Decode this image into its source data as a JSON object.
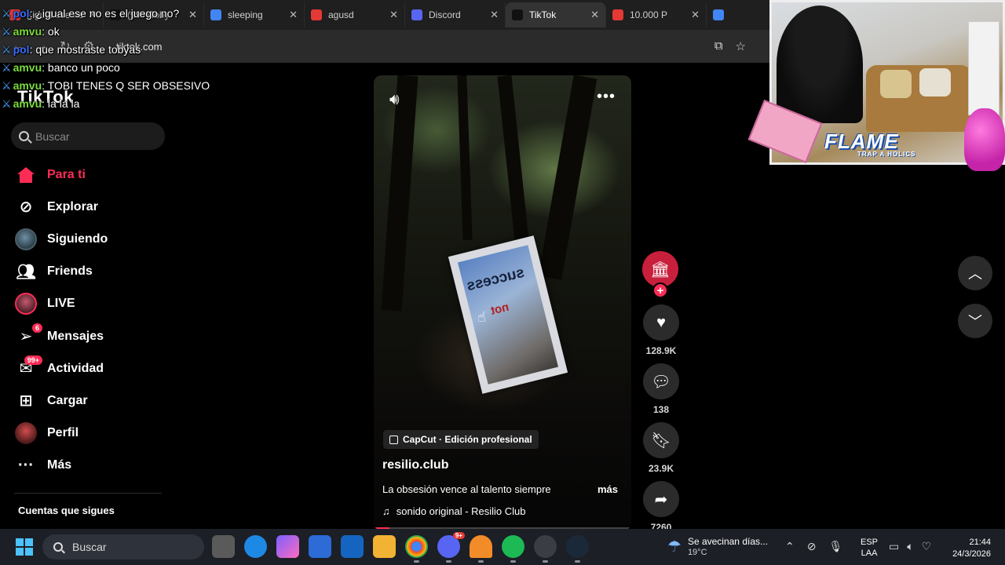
{
  "browser": {
    "tabs": [
      {
        "label": "¿igual ese no es el juego no?",
        "color": "#e53935",
        "active": false
      },
      {
        "label": "(99+)Toby",
        "color": "#111111",
        "active": false
      },
      {
        "label": "sleeping",
        "color": "#4285f4",
        "active": false
      },
      {
        "label": "agusd",
        "color": "#e53935",
        "active": false
      },
      {
        "label": "Discord",
        "color": "#5865f2",
        "active": false
      },
      {
        "label": "TikTok",
        "color": "#111111",
        "active": true
      },
      {
        "label": "10.000 P",
        "color": "#e53935",
        "active": false
      },
      {
        "label": "",
        "color": "#4285f4",
        "active": false
      }
    ],
    "url": "tiktok.com"
  },
  "chat": [
    {
      "user": "pol",
      "text": "¿igual ese no es el juego no?"
    },
    {
      "user": "amvu",
      "text": "ok"
    },
    {
      "user": "pol",
      "text": "que mostraste tobyas"
    },
    {
      "user": "amvu",
      "text": "banco un poco"
    },
    {
      "user": "amvu",
      "text": "TOBI TENES Q SER OBSESIVO"
    },
    {
      "user": "amvu",
      "text": "la la la"
    }
  ],
  "tiktok": {
    "logo": "TikTok",
    "search_placeholder": "Buscar",
    "nav": [
      {
        "label": "Para ti",
        "icon": "home-icon",
        "active": true
      },
      {
        "label": "Explorar",
        "icon": "compass-icon"
      },
      {
        "label": "Siguiendo",
        "icon": "following-avatar-icon"
      },
      {
        "label": "Friends",
        "icon": "friends-icon"
      },
      {
        "label": "LIVE",
        "icon": "live-avatar-icon"
      },
      {
        "label": "Mensajes",
        "icon": "messages-icon",
        "badge": "6"
      },
      {
        "label": "Actividad",
        "icon": "activity-icon",
        "badge": "99+"
      },
      {
        "label": "Cargar",
        "icon": "upload-icon"
      },
      {
        "label": "Perfil",
        "icon": "profile-avatar-icon"
      },
      {
        "label": "Más",
        "icon": "more-icon"
      }
    ],
    "following_title": "Cuentas que sigues"
  },
  "video": {
    "sign_word_1": "success",
    "sign_word_2": "not",
    "capcut_label": "CapCut · Edición profesional",
    "author": "resilio.club",
    "description": "La obsesión vence al talento siempre",
    "more_label": "más",
    "sound": "sonido original - Resilio Club",
    "progress": 0.06
  },
  "actions": {
    "likes": "128.9K",
    "comments": "138",
    "saves": "23.9K",
    "shares": "7260"
  },
  "overlay": {
    "brand": "FLAME",
    "brand_sub": "TRAP A HOLICS"
  },
  "taskbar": {
    "search": "Buscar",
    "weather_text": "Se avecinan días...",
    "weather_temp": "19°C",
    "lang_1": "ESP",
    "lang_2": "LAA",
    "time": "21:44",
    "date": "24/3/2026",
    "discord_badge": "9+"
  }
}
